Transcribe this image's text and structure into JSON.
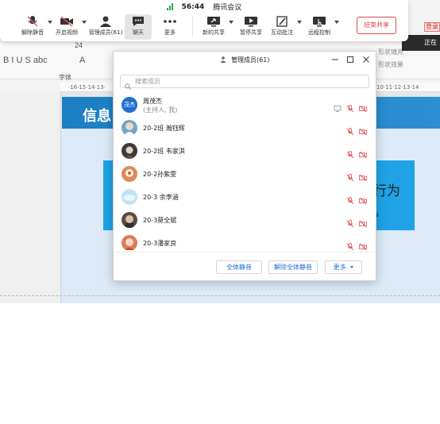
{
  "meeting_bar": {
    "timer": "56:44",
    "title": "腾讯会议",
    "buttons": [
      {
        "id": "unmute",
        "label": "解除静音",
        "icon": "mic-muted-icon"
      },
      {
        "id": "start_video",
        "label": "开启视频",
        "icon": "camera-off-icon"
      },
      {
        "id": "manage_members",
        "label": "管理成员(61)",
        "icon": "person-icon"
      },
      {
        "id": "chat",
        "label": "聊天",
        "icon": "chat-icon"
      },
      {
        "id": "more",
        "label": "更多",
        "icon": "more-dots-icon"
      },
      {
        "id": "new_share",
        "label": "新的共享",
        "icon": "screen-share-icon"
      },
      {
        "id": "pause_share",
        "label": "暂停共享",
        "icon": "pause-share-icon"
      },
      {
        "id": "annotate",
        "label": "互动批注",
        "icon": "annotate-icon"
      },
      {
        "id": "remote_control",
        "label": "远程控制",
        "icon": "remote-control-icon"
      }
    ],
    "end_share": "结束共享",
    "colors": {
      "end_share": "#e04a4a",
      "signal": "#27b148"
    }
  },
  "background_app": {
    "font_group": "字体",
    "ribbon_font_size": "24",
    "ribbon_format": "B I U S abc",
    "ruler_left": "·16·15·14·13·",
    "ruler_right": "10·11·12·13·14",
    "slide_title": "信息",
    "slide_text_1": "行为",
    "slide_text_2": "。",
    "shape_fill": "形状填充",
    "shape_effect": "形状效果",
    "corner_badge": "登录",
    "corner_dark": "正在"
  },
  "members_panel": {
    "title": "管理成员(61)",
    "search_placeholder": "搜索成员",
    "members": [
      {
        "name": "周茂杰",
        "sub": "(主持人, 我)",
        "avatar_text": "茂杰",
        "avatar_color": "#1f6fd1"
      },
      {
        "name": "20-2班 瀚钰辉",
        "avatar_color": "#6aa7c8"
      },
      {
        "name": "20-2班 韦家淇",
        "avatar_color": "#3b3b3b"
      },
      {
        "name": "20-2孙紫雯",
        "avatar_color": "#e08a5a"
      },
      {
        "name": "20-3 余李涵",
        "avatar_color": "#bfe3f3"
      },
      {
        "name": "20-3莫全斌",
        "avatar_color": "#5b4a40"
      },
      {
        "name": "20-3潘家良",
        "avatar_color": "#e07a52"
      }
    ],
    "footer": {
      "mute_all": "全体静音",
      "unmute_all": "解除全体静音",
      "more": "更多"
    },
    "colors": {
      "muted_icon": "#e35d5d",
      "link": "#1f6fd1"
    }
  }
}
